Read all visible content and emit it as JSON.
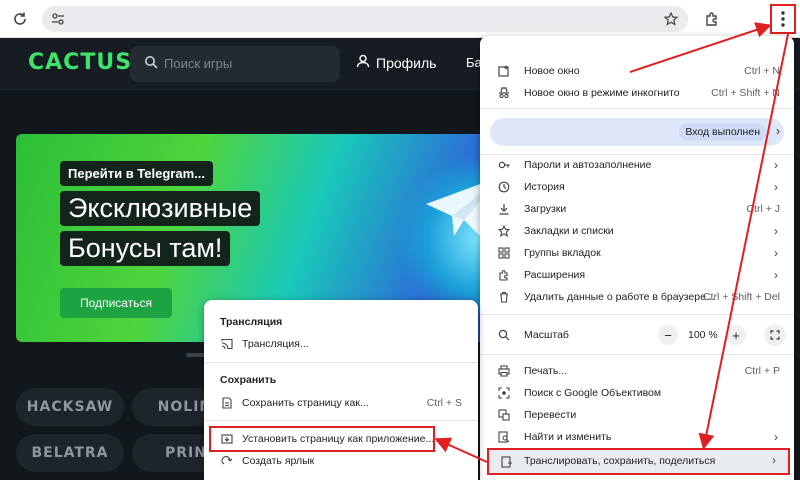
{
  "browser": {
    "icons": [
      "reload-icon",
      "site-settings-icon",
      "bookmark-star-icon",
      "extensions-icon",
      "menu-kebab-icon"
    ],
    "accent": "#e02020"
  },
  "site": {
    "logo": "CACTUS",
    "search_placeholder": "Поиск игры",
    "profile": "Профиль",
    "cut_nav": "Ба",
    "banner": {
      "small": "Перейти в Telegram...",
      "line1": "Эксклюзивные",
      "line2": "Бонусы там!",
      "button": "Подписаться"
    },
    "providers": [
      "HACKSAW",
      "NOLIM",
      "BELATRA",
      "PRIN"
    ]
  },
  "menu": {
    "items_top": [
      {
        "label": "Новое окно",
        "shortcut": "Ctrl + N",
        "icon": "new-window-icon"
      },
      {
        "label": "Новое окно в режиме инкогнито",
        "shortcut": "Ctrl + Shift + N",
        "icon": "incognito-icon"
      }
    ],
    "account": "Вход выполнен",
    "items_mid": [
      {
        "label": "Пароли и автозаполнение",
        "shortcut": "",
        "arrow": true,
        "icon": "key-icon"
      },
      {
        "label": "История",
        "shortcut": "",
        "arrow": true,
        "icon": "history-icon"
      },
      {
        "label": "Загрузки",
        "shortcut": "Ctrl + J",
        "arrow": false,
        "icon": "download-icon"
      },
      {
        "label": "Закладки и списки",
        "shortcut": "",
        "arrow": true,
        "icon": "bookmark-star-icon"
      },
      {
        "label": "Группы вкладок",
        "shortcut": "",
        "arrow": true,
        "icon": "tab-groups-icon"
      },
      {
        "label": "Расширения",
        "shortcut": "",
        "arrow": true,
        "icon": "extensions-icon"
      },
      {
        "label": "Удалить данные о работе в браузере...",
        "shortcut": "Ctrl + Shift + Del",
        "arrow": false,
        "icon": "trash-icon"
      }
    ],
    "zoom": {
      "label": "Масштаб",
      "value": "100 %",
      "minus": "−",
      "plus": "+"
    },
    "items_bottom": [
      {
        "label": "Печать...",
        "shortcut": "Ctrl + P",
        "arrow": false,
        "icon": "print-icon"
      },
      {
        "label": "Поиск с Google Объективом",
        "shortcut": "",
        "arrow": false,
        "icon": "lens-icon"
      },
      {
        "label": "Перевести",
        "shortcut": "",
        "arrow": false,
        "icon": "translate-icon"
      },
      {
        "label": "Найти и изменить",
        "shortcut": "",
        "arrow": true,
        "icon": "find-icon"
      },
      {
        "label": "Транслировать, сохранить, поделиться",
        "shortcut": "",
        "arrow": true,
        "icon": "cast-save-share-icon"
      }
    ]
  },
  "submenu": {
    "heading_cast": "Трансляция",
    "cast_item": "Трансляция...",
    "heading_save": "Сохранить",
    "save_item": "Сохранить страницу как...",
    "save_shortcut": "Ctrl + S",
    "install_item": "Установить страницу как приложение...",
    "shortcut_item": "Создать ярлык"
  }
}
